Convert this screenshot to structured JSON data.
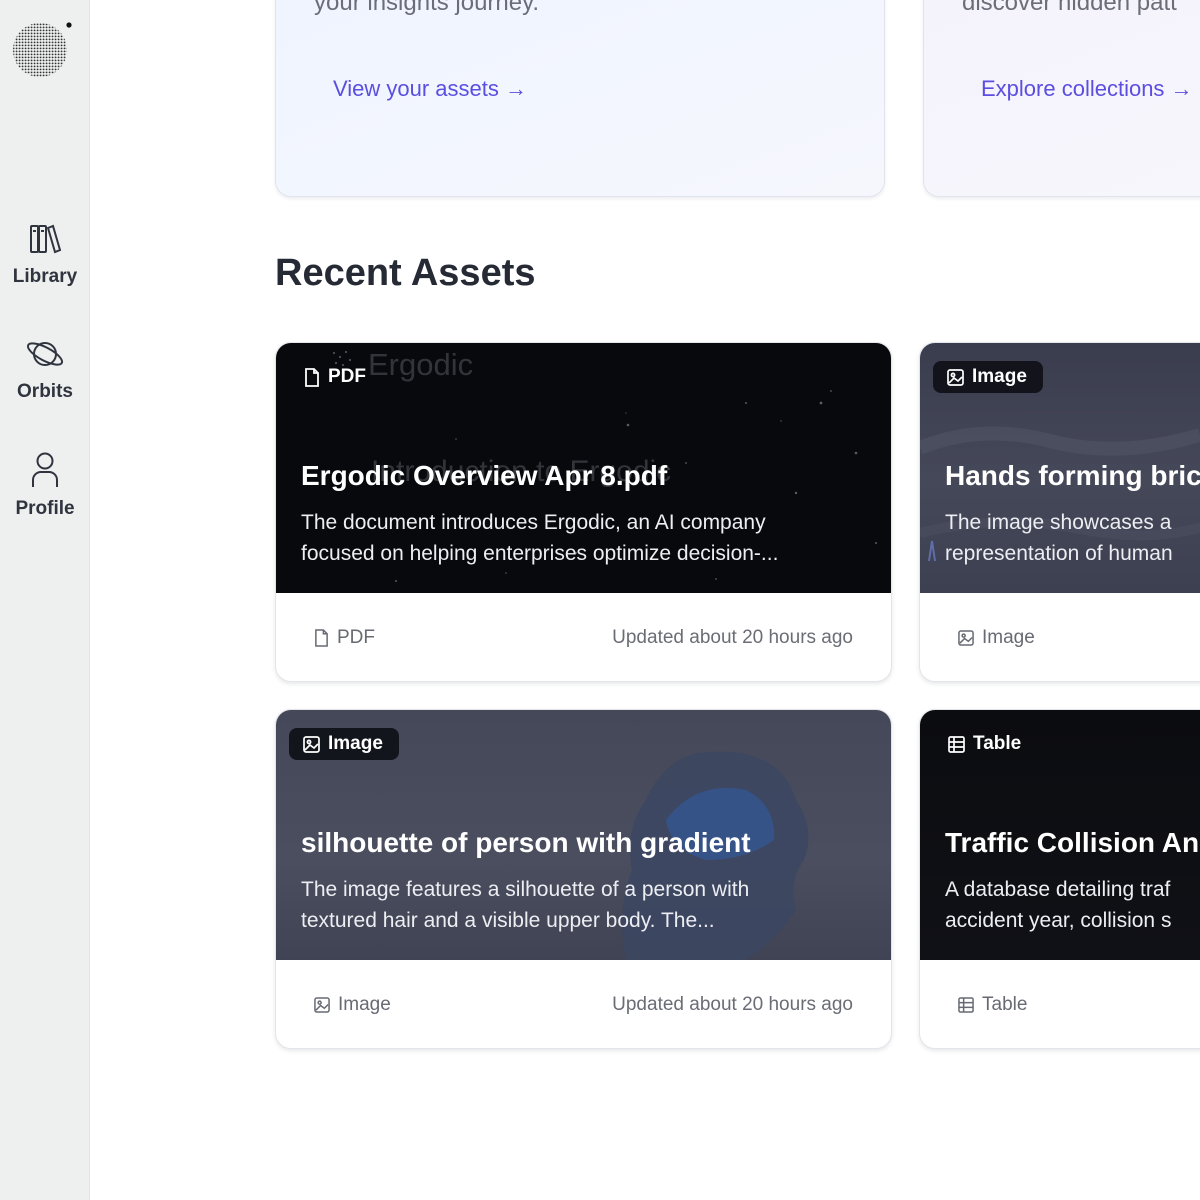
{
  "sidebar": {
    "items": [
      {
        "label": "Library",
        "icon": "library-icon"
      },
      {
        "label": "Orbits",
        "icon": "planet-icon"
      },
      {
        "label": "Profile",
        "icon": "user-icon"
      }
    ]
  },
  "promos": [
    {
      "text": "your insights journey.",
      "link": "View your assets →"
    },
    {
      "text": "discover hidden patt",
      "link": "Explore collections →"
    }
  ],
  "section_title": "Recent Assets",
  "assets": [
    {
      "badge": "PDF",
      "title": "Ergodic Overview Apr 8.pdf",
      "description": "The document introduces Ergodic, an AI company\nfocused on helping enterprises optimize decision-...",
      "footer_type": "PDF",
      "updated": "Updated about 20 hours ago",
      "icon": "file-icon"
    },
    {
      "badge": "Image",
      "title": "Hands forming bric",
      "description": "The image showcases a\nrepresentation of human",
      "footer_type": "Image",
      "updated": "",
      "icon": "image-icon"
    },
    {
      "badge": "Image",
      "title": "silhouette of person with gradient",
      "description": "The image features a silhouette of a person with\ntextured hair and a visible upper body. The...",
      "footer_type": "Image",
      "updated": "Updated about 20 hours ago",
      "icon": "image-icon"
    },
    {
      "badge": "Table",
      "title": "Traffic Collision An",
      "description": "A database detailing traf\naccident year, collision s",
      "footer_type": "Table",
      "updated": "",
      "icon": "table-icon"
    }
  ],
  "hero_overlay_text": {
    "brand": "Ergodic",
    "intro": "Introduction to Ergodic"
  },
  "colors": {
    "accent": "#5b4ee0",
    "sidebar_bg": "#eef0ef",
    "text_dark": "#262a35"
  }
}
